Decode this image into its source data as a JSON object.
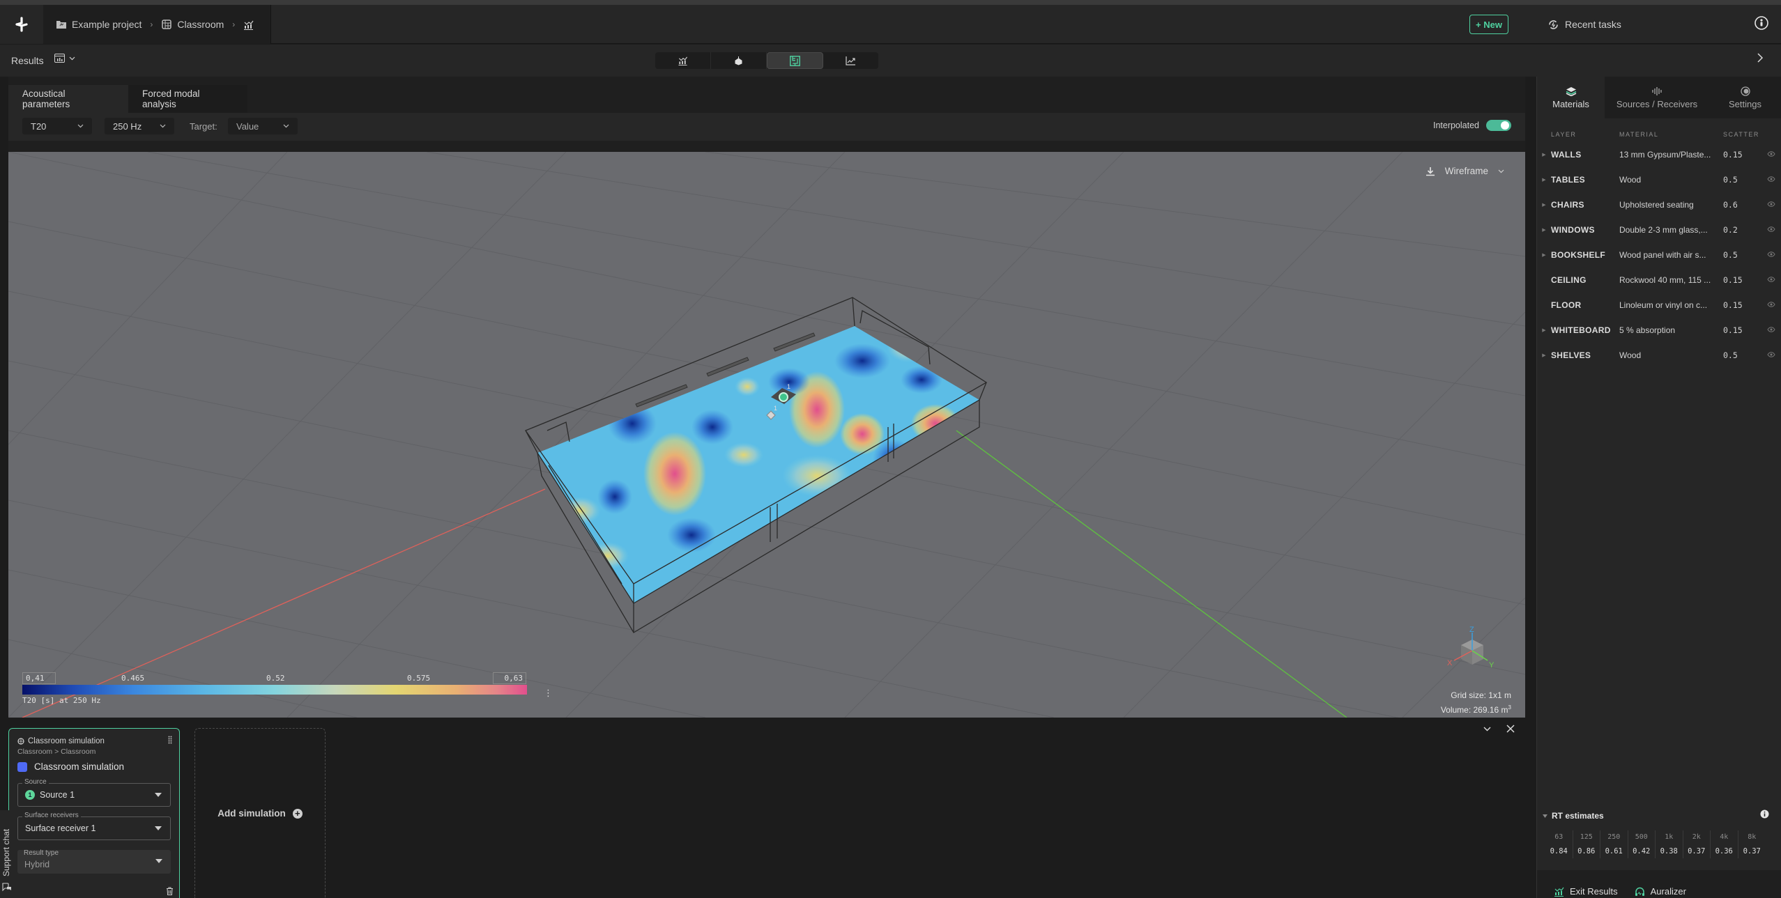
{
  "header": {
    "breadcrumb": [
      {
        "label": "Example project",
        "icon": "project-folder-icon"
      },
      {
        "label": "Classroom",
        "icon": "model-cube-icon"
      },
      {
        "label": "",
        "icon": "results-chart-icon"
      }
    ],
    "new_label": "+ New",
    "recent_tasks_label": "Recent tasks"
  },
  "subbar": {
    "results_label": "Results",
    "view_modes": [
      {
        "name": "results-chart",
        "active": false
      },
      {
        "name": "sources-receivers",
        "active": false
      },
      {
        "name": "surface-heatmap",
        "active": true
      },
      {
        "name": "trend-graph",
        "active": false
      }
    ]
  },
  "tabs": [
    {
      "label": "Acoustical parameters",
      "active": true
    },
    {
      "label": "Forced modal analysis",
      "active": false
    }
  ],
  "controls": {
    "parameter": "T20",
    "frequency": "250 Hz",
    "target_label": "Target:",
    "target_value": "Value",
    "interpolated_label": "Interpolated",
    "interpolated": true
  },
  "viewport": {
    "wireframe_label": "Wireframe",
    "legend": {
      "min": "0,41",
      "max": "0,63",
      "ticks": [
        "0.465",
        "0.52",
        "0.575"
      ],
      "caption": "T20 [s] at 250 Hz"
    },
    "axes": {
      "x": "X",
      "y": "Y",
      "z": "Z"
    },
    "grid_size": "Grid size: 1x1 m",
    "volume": "Volume: 269.16 m",
    "volume_unit_sup": "3",
    "source_label": "1",
    "receiver_label": "1"
  },
  "simulation_card": {
    "title": "Classroom simulation",
    "path": "Classroom > Classroom",
    "name": "Classroom simulation",
    "color": "#4f6af5",
    "source_label": "Source",
    "source_number": "1",
    "source_value": "Source 1",
    "receivers_label": "Surface receivers",
    "receivers_value": "Surface receiver 1",
    "result_type_label": "Result type",
    "result_type_value": "Hybrid"
  },
  "add_simulation_label": "Add simulation",
  "support_chat_label": "Support chat",
  "right_panel": {
    "tabs": [
      {
        "label": "Materials",
        "active": true
      },
      {
        "label": "Sources / Receivers",
        "active": false
      },
      {
        "label": "Settings",
        "active": false
      }
    ],
    "columns": [
      "LAYER",
      "MATERIAL",
      "SCATTER"
    ],
    "materials": [
      {
        "layer": "WALLS",
        "material": "13 mm Gypsum/Plaste...",
        "scatter": "0.15",
        "expandable": true
      },
      {
        "layer": "TABLES",
        "material": "Wood",
        "scatter": "0.5",
        "expandable": true
      },
      {
        "layer": "CHAIRS",
        "material": "Upholstered seating",
        "scatter": "0.6",
        "expandable": true
      },
      {
        "layer": "WINDOWS",
        "material": "Double 2-3 mm glass,...",
        "scatter": "0.2",
        "expandable": true
      },
      {
        "layer": "BOOKSHELF",
        "material": "Wood panel with air s...",
        "scatter": "0.5",
        "expandable": true
      },
      {
        "layer": "CEILING",
        "material": "Rockwool 40 mm, 115 ...",
        "scatter": "0.15",
        "expandable": false
      },
      {
        "layer": "FLOOR",
        "material": "Linoleum or vinyl on c...",
        "scatter": "0.15",
        "expandable": false
      },
      {
        "layer": "WHITEBOARD",
        "material": "5 % absorption",
        "scatter": "0.15",
        "expandable": true
      },
      {
        "layer": "SHELVES",
        "material": "Wood",
        "scatter": "0.5",
        "expandable": true
      }
    ],
    "rt_estimates": {
      "title": "RT estimates",
      "bands": [
        "63",
        "125",
        "250",
        "500",
        "1k",
        "2k",
        "4k",
        "8k"
      ],
      "values": [
        "0.84",
        "0.86",
        "0.61",
        "0.42",
        "0.38",
        "0.37",
        "0.36",
        "0.37"
      ]
    },
    "footer": {
      "exit_label": "Exit Results",
      "auralizer_label": "Auralizer"
    }
  },
  "colors": {
    "accent": "#4fd1a0",
    "toggle_on": "#4cba98",
    "viewport_bg": "#6a6b6f"
  }
}
